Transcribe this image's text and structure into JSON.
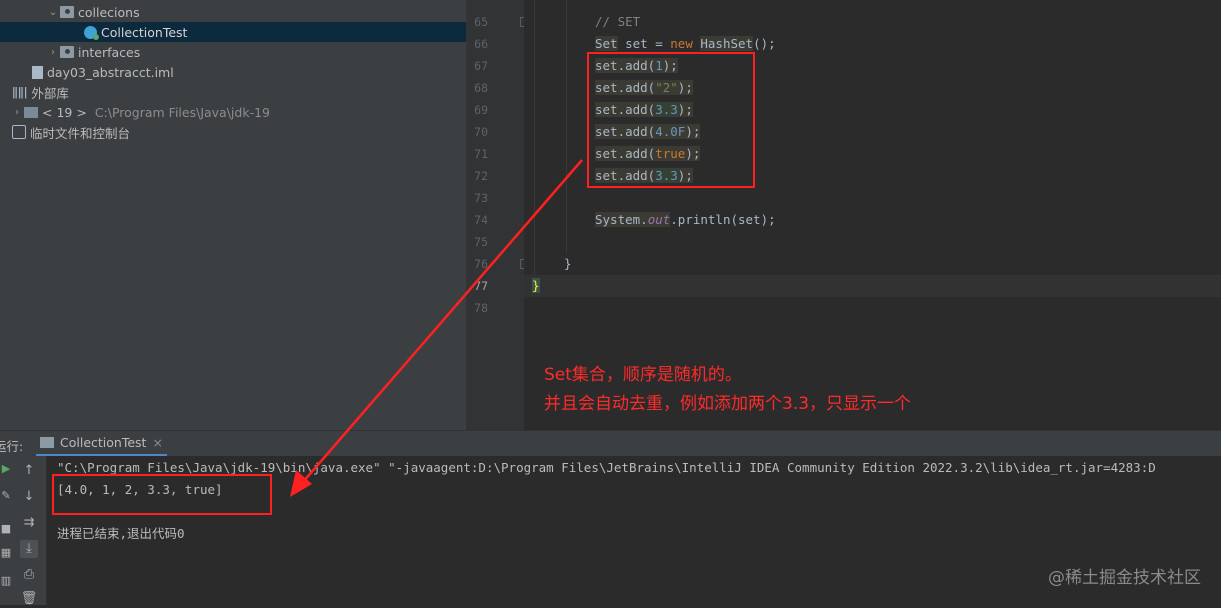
{
  "project_tree": {
    "items": [
      {
        "label": "collecions",
        "icon": "folder-icon"
      },
      {
        "label": "CollectionTest",
        "icon": "java-class-icon"
      },
      {
        "label": "interfaces",
        "icon": "folder-icon"
      },
      {
        "label": "day03_abstracct.iml",
        "icon": "module-file-icon"
      },
      {
        "label": "外部库",
        "icon": "library-icon"
      },
      {
        "label": "< 19 >",
        "path": "C:\\Program Files\\Java\\jdk-19",
        "icon": "jdk-icon"
      },
      {
        "label": "临时文件和控制台",
        "icon": "scratch-icon"
      }
    ]
  },
  "editor": {
    "line_numbers": [
      "65",
      "66",
      "67",
      "68",
      "69",
      "70",
      "71",
      "72",
      "73",
      "74",
      "75",
      "76",
      "77",
      "78"
    ],
    "current_line": "77",
    "lines": {
      "l65": "// SET",
      "l66_type": "Set",
      "l66_rest": " set = ",
      "l66_new": "new",
      "l66_ctor": "HashSet",
      "l66_end": "();",
      "add_prefix": "set.add(",
      "add_suffix": ");",
      "l67_arg": "1",
      "l68_arg": "\"2\"",
      "l69_arg": "3.3",
      "l70_arg": "4.0F",
      "l71_arg": "true",
      "l72_arg": "3.3",
      "l74_sys": "System.",
      "l74_out": "out",
      "l74_rest": ".println(set);",
      "l76": "}",
      "l77": "}"
    },
    "annotation": {
      "line1": "Set集合，顺序是随机的。",
      "line2": "并且会自动去重，例如添加两个3.3，只显示一个"
    }
  },
  "run_panel": {
    "label": "运行:",
    "tab_label": "CollectionTest",
    "tab_close": "×",
    "command_line": "\"C:\\Program Files\\Java\\jdk-19\\bin\\java.exe\" \"-javaagent:D:\\Program Files\\JetBrains\\IntelliJ IDEA Community Edition 2022.3.2\\lib\\idea_rt.jar=4283:D",
    "output": "[4.0, 1, 2, 3.3, true]",
    "exit_message": "进程已结束,退出代码0"
  },
  "watermark": "@稀土掘金技术社区",
  "colors": {
    "annotation_red": "#ff2121",
    "keyword_orange": "#cc7832",
    "string_green": "#6a8759",
    "number_blue": "#6897bb"
  }
}
